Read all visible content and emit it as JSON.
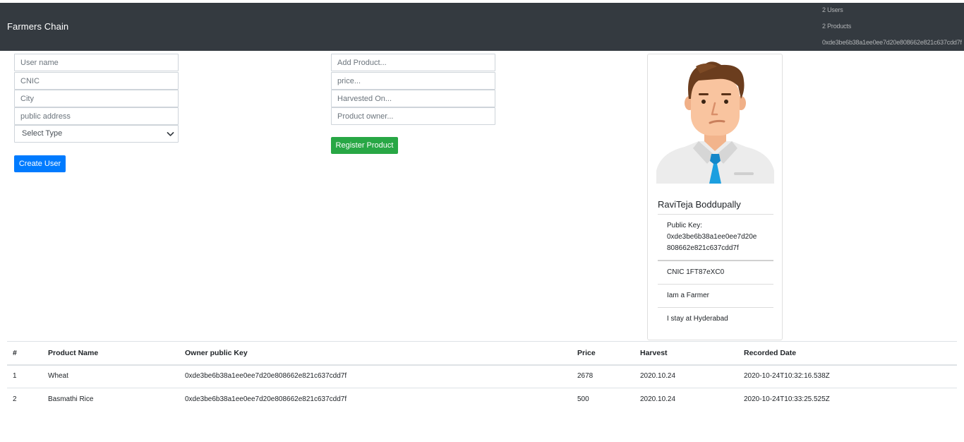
{
  "navbar": {
    "brand": "Farmers Chain",
    "users": "2 Users",
    "products": "2 Products",
    "account": "0xde3be6b38a1ee0ee7d20e808662e821c637cdd7f"
  },
  "user_form": {
    "username_placeholder": "User name",
    "cnic_placeholder": "CNIC",
    "city_placeholder": "City",
    "address_placeholder": "public address",
    "type_selected": "Select Type",
    "create_label": "Create User"
  },
  "product_form": {
    "product_placeholder": "Add Product...",
    "price_placeholder": "price...",
    "harvested_placeholder": "Harvested On...",
    "owner_placeholder": "Product owner...",
    "register_label": "Register Product"
  },
  "profile": {
    "avatar_icon": "man-avatar-icon",
    "name": "RaviTeja Boddupally",
    "public_key_label": "Public Key:",
    "public_key_line1": "0xde3be6b38a1ee0ee7d20e",
    "public_key_line2": "808662e821c637cdd7f",
    "cnic": "CNIC 1FT87eXC0",
    "role": "Iam a Farmer",
    "location": "I stay at Hyderabad"
  },
  "table": {
    "headers": [
      "#",
      "Product Name",
      "Owner public Key",
      "Price",
      "Harvest",
      "Recorded Date"
    ],
    "rows": [
      [
        "1",
        "Wheat",
        "0xde3be6b38a1ee0ee7d20e808662e821c637cdd7f",
        "2678",
        "2020.10.24",
        "2020-10-24T10:32:16.538Z"
      ],
      [
        "2",
        "Basmathi Rice",
        "0xde3be6b38a1ee0ee7d20e808662e821c637cdd7f",
        "500",
        "2020.10.24",
        "2020-10-24T10:33:25.525Z"
      ]
    ]
  },
  "colors": {
    "navbar": "#343a40",
    "primary": "#007bff",
    "success": "#28a745"
  }
}
